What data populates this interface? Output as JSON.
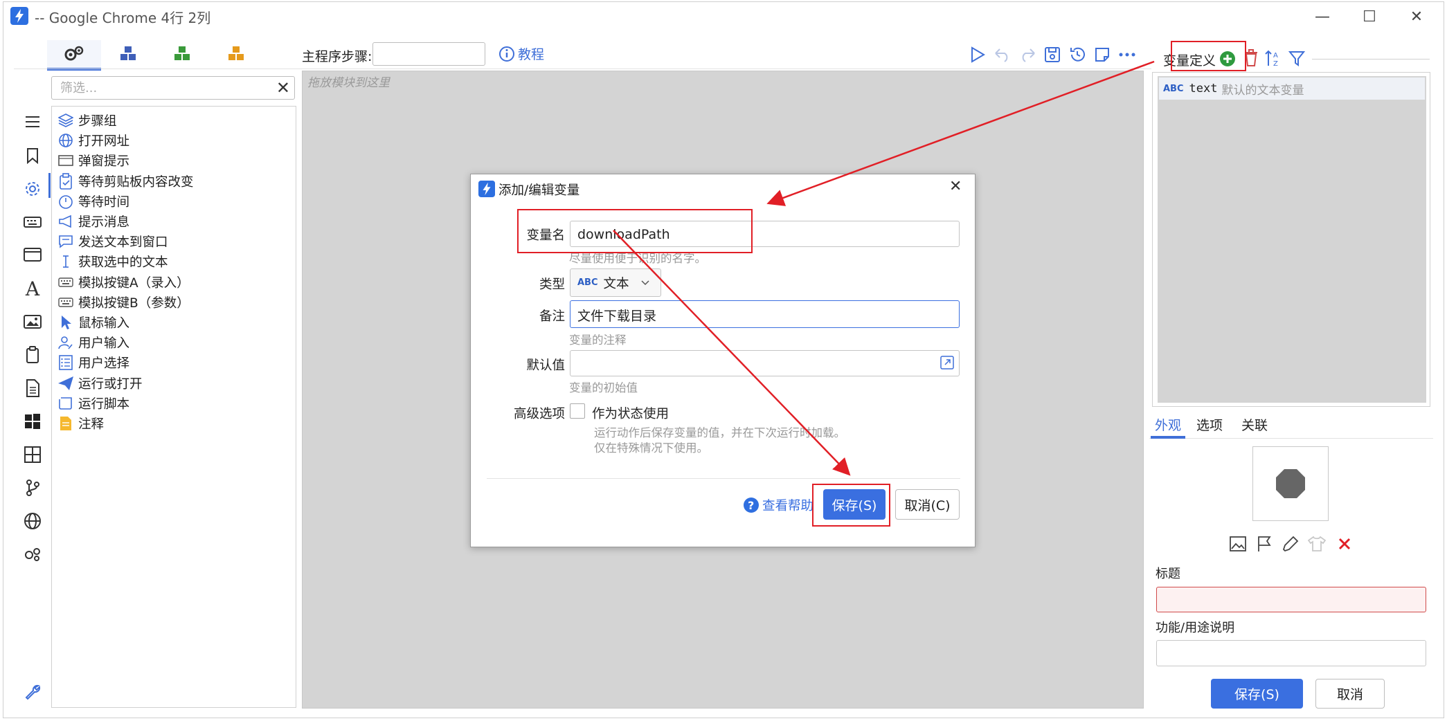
{
  "window": {
    "title": "-- Google Chrome 4行 2列",
    "minimize": "—",
    "maximize": "☐",
    "close": "✕"
  },
  "filter": {
    "placeholder": "筛选...",
    "clear": "✕"
  },
  "modules": [
    {
      "label": "步骤组",
      "icon": "layers-icon"
    },
    {
      "label": "打开网址",
      "icon": "globe-icon"
    },
    {
      "label": "弹窗提示",
      "icon": "popup-icon"
    },
    {
      "label": "等待剪贴板内容改变",
      "icon": "clipboard-icon"
    },
    {
      "label": "等待时间",
      "icon": "timer-icon"
    },
    {
      "label": "提示消息",
      "icon": "megaphone-icon"
    },
    {
      "label": "发送文本到窗口",
      "icon": "chat-icon"
    },
    {
      "label": "获取选中的文本",
      "icon": "text-cursor-icon"
    },
    {
      "label": "模拟按键A（录入）",
      "icon": "keyboard-icon"
    },
    {
      "label": "模拟按键B（参数）",
      "icon": "keyboard-icon"
    },
    {
      "label": "鼠标输入",
      "icon": "mouse-pointer-icon"
    },
    {
      "label": "用户输入",
      "icon": "user-edit-icon"
    },
    {
      "label": "用户选择",
      "icon": "list-check-icon"
    },
    {
      "label": "运行或打开",
      "icon": "paper-plane-icon"
    },
    {
      "label": "运行脚本",
      "icon": "script-icon"
    },
    {
      "label": "注释",
      "icon": "note-icon"
    }
  ],
  "toolbar": {
    "step_label": "主程序步骤:",
    "step_value": "",
    "tutorial": "教程"
  },
  "canvas": {
    "hint": "拖放模块到这里"
  },
  "right_panel": {
    "title": "变量定义",
    "variables": [
      {
        "type": "ABC",
        "name": "text",
        "desc": "默认的文本变量"
      }
    ],
    "tabs": [
      "外观",
      "选项",
      "关联"
    ],
    "title_label": "标题",
    "desc_label": "功能/用途说明",
    "title_value": "",
    "desc_value": "",
    "save": "保存(S)",
    "cancel": "取消"
  },
  "dialog": {
    "title": "添加/编辑变量",
    "close": "✕",
    "name_label": "变量名",
    "name_value": "downloadPath",
    "name_hint": "尽量使用便于识别的名字。",
    "type_label": "类型",
    "type_badge": "ABC",
    "type_value": "文本",
    "note_label": "备注",
    "note_value": "文件下载目录",
    "note_hint": "变量的注释",
    "default_label": "默认值",
    "default_value": "",
    "default_hint": "变量的初始值",
    "adv_label": "高级选项",
    "adv_checkbox": "作为状态使用",
    "adv_hint1": "运行动作后保存变量的值，并在下次运行时加载。",
    "adv_hint2": "仅在特殊情况下使用。",
    "help": "查看帮助",
    "save": "保存(S)",
    "cancel": "取消(C)"
  },
  "colors": {
    "accent": "#3a6fe0",
    "annotation": "#e11f26",
    "canvas": "#d4d4d4"
  }
}
